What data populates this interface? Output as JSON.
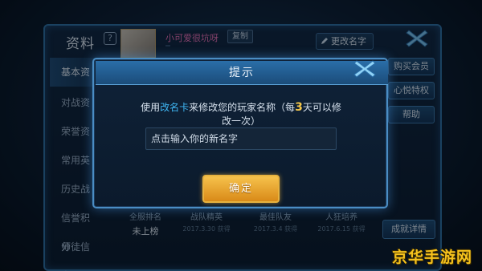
{
  "profile": {
    "title": "资料",
    "help_glyph": "?",
    "player_name": "小可爱很坑呀",
    "copy_label": "复制",
    "rename_label": "更改名字"
  },
  "sidebar": {
    "items": [
      {
        "label": "基本资"
      },
      {
        "label": "对战资"
      },
      {
        "label": "荣誉资"
      },
      {
        "label": "常用英"
      },
      {
        "label": "历史战"
      },
      {
        "label": "信誉积分"
      },
      {
        "label": "师徒信息"
      }
    ]
  },
  "side_buttons": {
    "buy_member": "购买会员",
    "wish_power": "心悦特权",
    "help": "帮助",
    "achievement_detail": "成就详情"
  },
  "stats": {
    "rank_label": "全服排名",
    "rank_value": "未上榜",
    "items": [
      {
        "value": "战队精英",
        "date": "2017.3.30 获得"
      },
      {
        "value": "最佳队友",
        "date": "2017.3.4 获得"
      },
      {
        "value": "人狂培养",
        "date": "2017.6.15 获得"
      }
    ]
  },
  "dialog": {
    "title": "提示",
    "msg_part1": "使用",
    "msg_card": "改名卡",
    "msg_part2": "来修改您的玩家名称（每",
    "msg_days": "3",
    "msg_part3": "天可以修改一次）",
    "input_placeholder": "点击输入你的新名字",
    "confirm_label": "确定"
  },
  "watermark": "京华手游网",
  "colors": {
    "accent_blue": "#3fb6f2",
    "accent_yellow": "#f3c64a",
    "confirm_gold": "#f6c24c",
    "name_pink": "#ec6fb4"
  }
}
